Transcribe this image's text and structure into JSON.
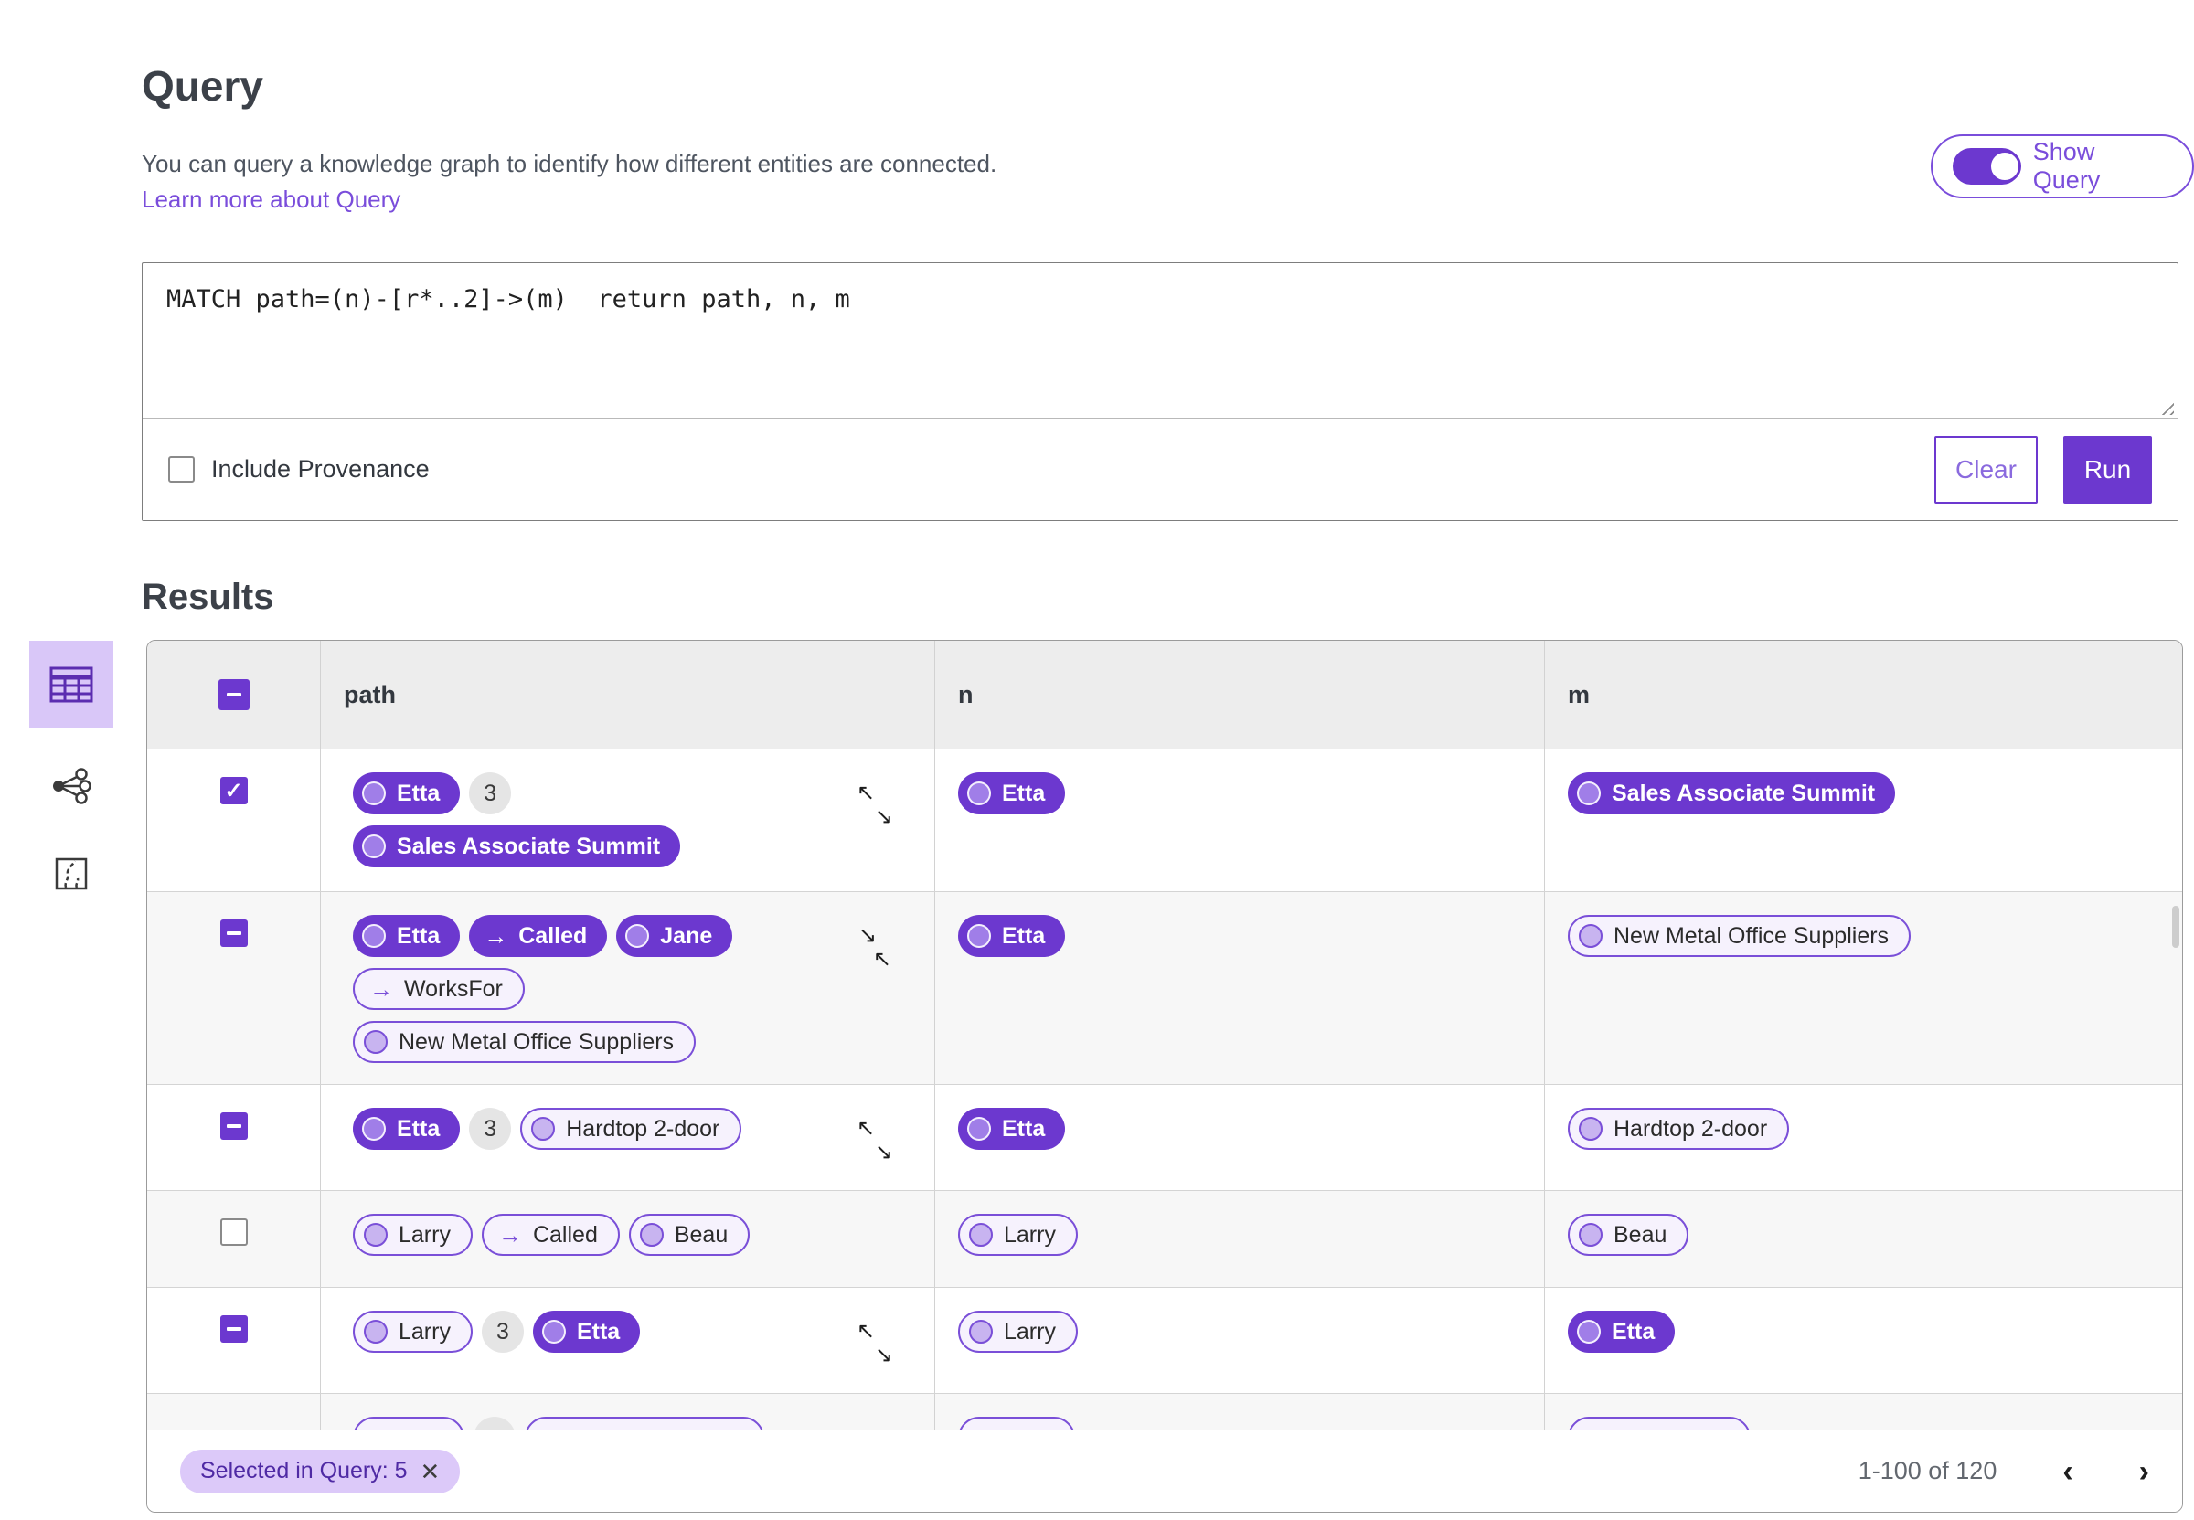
{
  "header": {
    "title": "Query",
    "description": "You can query a knowledge graph to identify how different entities are connected.",
    "learn_more": "Learn more about Query",
    "show_query_label": "Show Query"
  },
  "query_editor": {
    "query_text": "MATCH path=(n)-[r*..2]->(m)  return path, n, m",
    "include_provenance_label": "Include Provenance",
    "clear_label": "Clear",
    "run_label": "Run"
  },
  "results": {
    "title": "Results",
    "columns": [
      "path",
      "n",
      "m"
    ],
    "select_all_state": "indeterminate",
    "rows": [
      {
        "checkbox": "checked",
        "expand_icon": "expand",
        "path": [
          [
            {
              "kind": "node",
              "style": "filled",
              "label": "Etta"
            },
            {
              "kind": "badge",
              "label": "3"
            }
          ],
          [
            {
              "kind": "node",
              "style": "filled",
              "label": "Sales Associate Summit"
            }
          ]
        ],
        "n": [
          {
            "kind": "node",
            "style": "filled",
            "label": "Etta"
          }
        ],
        "m": [
          {
            "kind": "node",
            "style": "filled",
            "label": "Sales Associate Summit"
          }
        ]
      },
      {
        "checkbox": "indeterminate",
        "expand_icon": "collapse",
        "path": [
          [
            {
              "kind": "node",
              "style": "filled",
              "label": "Etta"
            },
            {
              "kind": "edge",
              "style": "filled",
              "label": "Called"
            },
            {
              "kind": "node",
              "style": "filled",
              "label": "Jane"
            }
          ],
          [
            {
              "kind": "edge",
              "style": "outlined",
              "label": "WorksFor"
            }
          ],
          [
            {
              "kind": "node",
              "style": "outlined",
              "label": "New Metal Office Suppliers"
            }
          ]
        ],
        "n": [
          {
            "kind": "node",
            "style": "filled",
            "label": "Etta"
          }
        ],
        "m": [
          {
            "kind": "node",
            "style": "outlined",
            "label": "New Metal Office Suppliers"
          }
        ]
      },
      {
        "checkbox": "indeterminate",
        "expand_icon": "expand",
        "path": [
          [
            {
              "kind": "node",
              "style": "filled",
              "label": "Etta"
            },
            {
              "kind": "badge",
              "label": "3"
            },
            {
              "kind": "node",
              "style": "outlined",
              "label": "Hardtop 2-door"
            }
          ]
        ],
        "n": [
          {
            "kind": "node",
            "style": "filled",
            "label": "Etta"
          }
        ],
        "m": [
          {
            "kind": "node",
            "style": "outlined",
            "label": "Hardtop 2-door"
          }
        ]
      },
      {
        "checkbox": "unchecked",
        "expand_icon": null,
        "path": [
          [
            {
              "kind": "node",
              "style": "outlined",
              "label": "Larry"
            },
            {
              "kind": "edge",
              "style": "outlined",
              "label": "Called"
            },
            {
              "kind": "node",
              "style": "outlined",
              "label": "Beau"
            }
          ]
        ],
        "n": [
          {
            "kind": "node",
            "style": "outlined",
            "label": "Larry"
          }
        ],
        "m": [
          {
            "kind": "node",
            "style": "outlined",
            "label": "Beau"
          }
        ]
      },
      {
        "checkbox": "indeterminate",
        "expand_icon": "expand",
        "path": [
          [
            {
              "kind": "node",
              "style": "outlined",
              "label": "Larry"
            },
            {
              "kind": "badge",
              "label": "3"
            },
            {
              "kind": "node",
              "style": "filled",
              "label": "Etta"
            }
          ]
        ],
        "n": [
          {
            "kind": "node",
            "style": "outlined",
            "label": "Larry"
          }
        ],
        "m": [
          {
            "kind": "node",
            "style": "filled",
            "label": "Etta"
          }
        ]
      }
    ],
    "footer": {
      "filter_tag": "Selected in Query: 5",
      "page_info": "1-100 of 120",
      "prev_icon": "‹",
      "next_icon": "›"
    }
  },
  "colors": {
    "primary_purple": "#6c38cf",
    "link_purple": "#7a4ddb",
    "tag_background": "#dcc9f9",
    "outlined_pill_border": "#7a4fd8",
    "table_header_background": "#ededed"
  }
}
